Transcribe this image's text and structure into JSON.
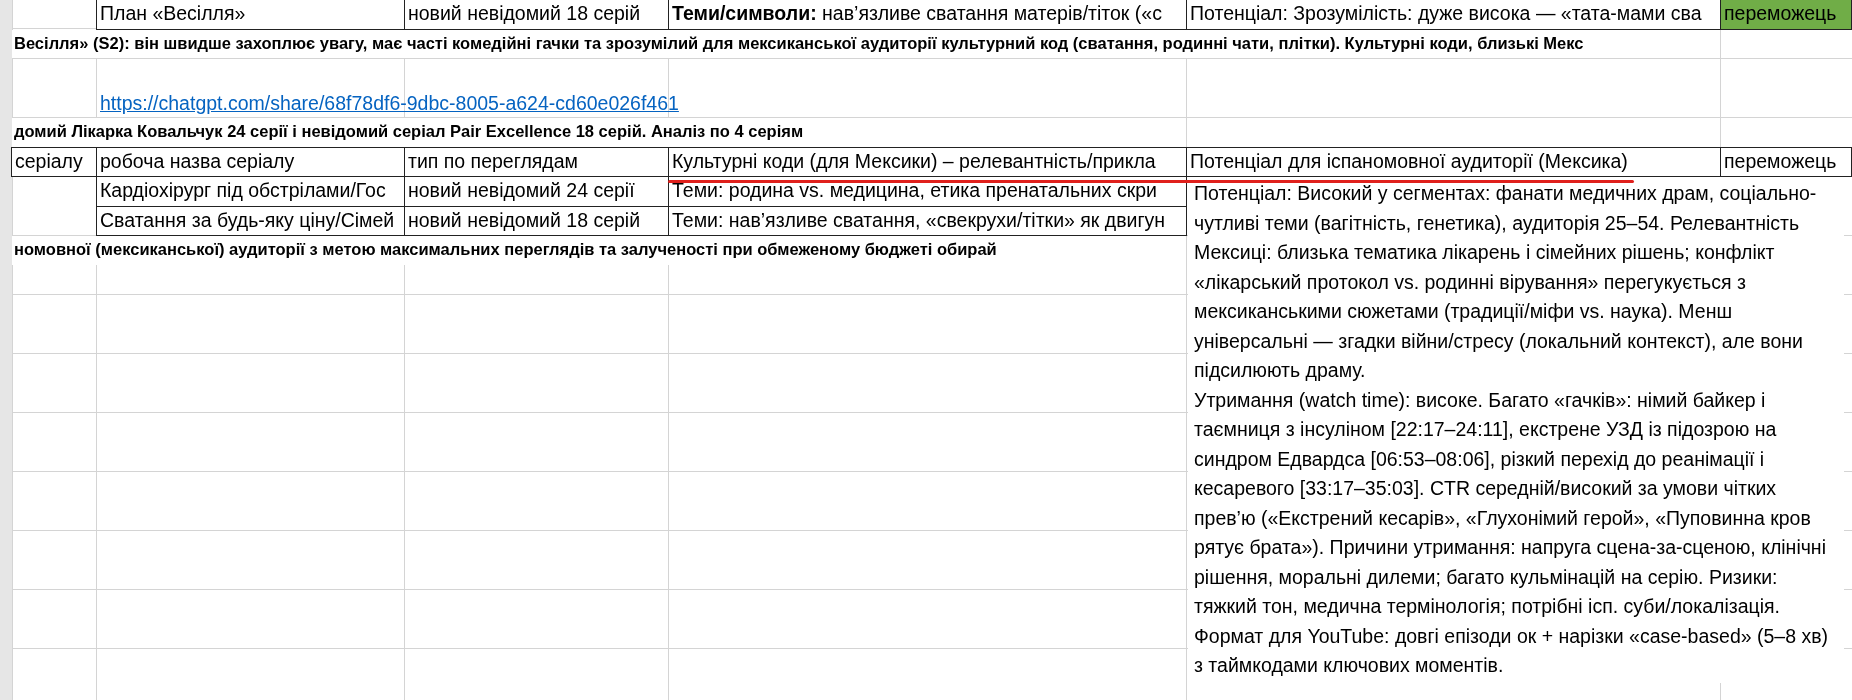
{
  "sheet": {
    "rows": [
      {
        "kind": "cells",
        "bordered": true,
        "cells": [
          null,
          "План «Весілля»",
          "новий невідомий 18 серій",
          "**Теми/символи:** нав’язливе сватання матерів/тіток («с",
          "Потенціал: Зрозумілість: дуже висока — «тата-мами сва",
          {
            "text": "переможець",
            "highlighted": true
          }
        ]
      },
      {
        "kind": "note",
        "text": "Весілля» (S2): він швидше захоплює увагу, має часті комедійні гачки та зрозумілий для мексиканської аудиторії культурний код (сватання, родинні чати, плітки). Культурні коди, близькі Мекс"
      },
      {
        "kind": "blank"
      },
      {
        "kind": "link",
        "text": "https://chatgpt.com/share/68f78df6-9dbc-8005-a624-cd60e026f461"
      },
      {
        "kind": "note",
        "text": "домий Лікарка Ковальчук 24 серії і невідомий серіал Pair Excellence 18 серій. Аналіз по 4 серіям"
      },
      {
        "kind": "cells",
        "bordered": true,
        "cells": [
          "серіалу",
          "робоча назва серіалу",
          "тип по переглядам",
          "Культурні коди (для Мексики) – релевантність/прикла",
          "Потенціал для іспаномовної аудиторії (Мексика)",
          {
            "text": "переможець",
            "highlighted": false
          }
        ]
      },
      {
        "kind": "cells",
        "bordered": true,
        "cells": [
          null,
          "Кардіохірург під обстрілами/Гос",
          "новий невідомий 24 серії",
          "Теми: родина vs. медицина, етика пренатальних скри",
          null,
          null
        ]
      },
      {
        "kind": "cells",
        "bordered": true,
        "cells": [
          null,
          "Сватання за будь-яку ціну/Сімей",
          "новий невідомий 18 серій",
          "Теми: нав’язливе сватання, «свекрухи/тітки» як двигун",
          null,
          null
        ]
      },
      {
        "kind": "note",
        "text": "номовної (мексиканської) аудиторії з метою максимальних переглядів та залученості при обмеженому бюджеті обирай"
      }
    ],
    "expanded_cell": {
      "paragraphs": [
        "Потенціал: Високий у сегментах: фанати медичних драм, соціально-чутливі теми (вагітність, генетика), аудиторія 25–54. Релевантність Мексиці: близька тематика лікарень і сімейних рішень; конфлікт «лікарський протокол vs. родинні вірування» перегукується з мексиканськими сюжетами (традиції/міфи vs. наука). Менш універсальні — згадки війни/стресу (локальний контекст), але вони підсилюють драму.",
        "Утримання (watch time): високе. Багато «гачків»: німий байкер і таємниця з інсуліном [22:17–24:11], екстрене УЗД із підозрою на синдром Едвардса [06:53–08:06], різкий перехід до реанімації і кесаревого [33:17–35:03]. CTR середній/високий за умови чітких прев’ю («Екстрений кесарів», «Глухонімий герой», «Пуповинна кров рятує брата»). Причини утримання: напруга сцена-за-сценою, клінічні рішення, моральні дилеми; багато кульмінацій на серію. Ризики: тяжкий тон, медична термінологія; потрібні ісп. суби/локалізація. Формат для YouTube: довгі епізоди ок + нарізки «case-based» (5–8 хв) з таймкодами ключових моментів."
      ]
    }
  }
}
